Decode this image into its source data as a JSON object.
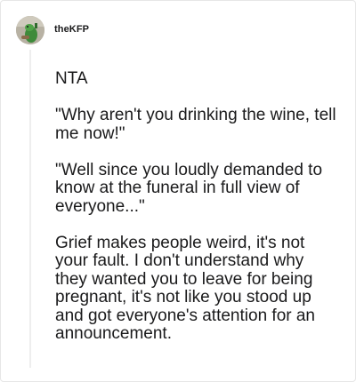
{
  "comment": {
    "username": "theKFP",
    "avatar_icon": "user-avatar-icon",
    "paragraphs": [
      "NTA",
      "\"Why aren't you drinking the wine, tell me now!\"",
      "\"Well since you loudly demanded to know at the funeral in full view of everyone...\"",
      "Grief makes people weird, it's not your fault. I don't understand why they wanted you to leave for being pregnant, it's not like you stood up and got everyone's attention for an announcement."
    ]
  },
  "colors": {
    "text": "#1a1a1b",
    "thread_line": "#eeeeee",
    "border": "#e6e6e6"
  }
}
